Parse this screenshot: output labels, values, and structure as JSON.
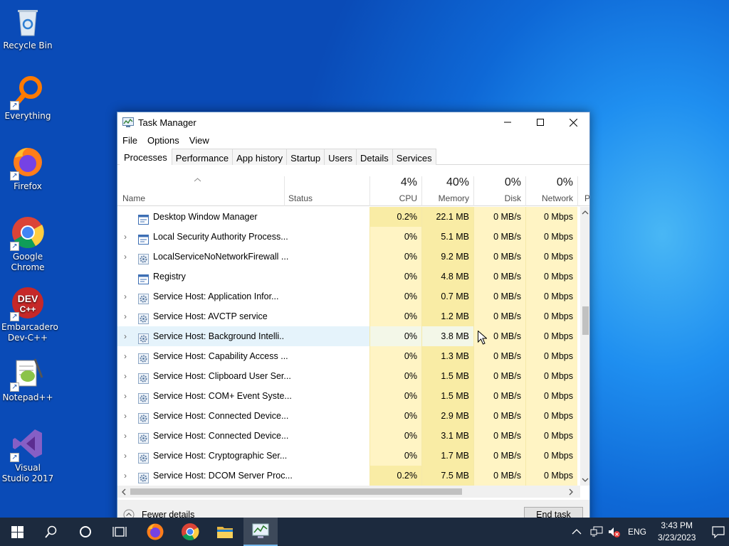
{
  "desktop": {
    "icons": [
      {
        "label": "Recycle Bin",
        "icon": "recycle-bin-icon"
      },
      {
        "label": "Everything",
        "icon": "everything-search-icon"
      },
      {
        "label": "Firefox",
        "icon": "firefox-icon"
      },
      {
        "label": "Google Chrome",
        "icon": "chrome-icon"
      },
      {
        "label": "Embarcadero Dev-C++",
        "icon": "devcpp-icon",
        "badge": "DEV C++"
      },
      {
        "label": "Notepad++",
        "icon": "notepadpp-icon"
      },
      {
        "label": "Visual Studio 2017",
        "icon": "visual-studio-icon"
      }
    ]
  },
  "window": {
    "title": "Task Manager",
    "menu": [
      "File",
      "Options",
      "View"
    ],
    "tabs": [
      "Processes",
      "Performance",
      "App history",
      "Startup",
      "Users",
      "Details",
      "Services"
    ],
    "active_tab": "Processes",
    "columns": {
      "name": "Name",
      "status": "Status",
      "cpu": {
        "label": "CPU",
        "pct": "4%"
      },
      "memory": {
        "label": "Memory",
        "pct": "40%"
      },
      "disk": {
        "label": "Disk",
        "pct": "0%"
      },
      "network": {
        "label": "Network",
        "pct": "0%"
      },
      "power": "P"
    },
    "processes": [
      {
        "name": "Desktop Window Manager",
        "cpu": "0.2%",
        "memory": "22.1 MB",
        "disk": "0 MB/s",
        "network": "0 Mbps",
        "expandable": false,
        "icon": "window-process-icon"
      },
      {
        "name": "Local Security Authority Process...",
        "cpu": "0%",
        "memory": "5.1 MB",
        "disk": "0 MB/s",
        "network": "0 Mbps",
        "expandable": true,
        "icon": "window-process-icon"
      },
      {
        "name": "LocalServiceNoNetworkFirewall ...",
        "cpu": "0%",
        "memory": "9.2 MB",
        "disk": "0 MB/s",
        "network": "0 Mbps",
        "expandable": true,
        "icon": "service-gear-icon"
      },
      {
        "name": "Registry",
        "cpu": "0%",
        "memory": "4.8 MB",
        "disk": "0 MB/s",
        "network": "0 Mbps",
        "expandable": false,
        "icon": "window-process-icon"
      },
      {
        "name": "Service Host: Application Infor...",
        "cpu": "0%",
        "memory": "0.7 MB",
        "disk": "0 MB/s",
        "network": "0 Mbps",
        "expandable": true,
        "icon": "service-gear-icon"
      },
      {
        "name": "Service Host: AVCTP service",
        "cpu": "0%",
        "memory": "1.2 MB",
        "disk": "0 MB/s",
        "network": "0 Mbps",
        "expandable": true,
        "icon": "service-gear-icon"
      },
      {
        "name": "Service Host: Background Intelli...",
        "cpu": "0%",
        "memory": "3.8 MB",
        "disk": "0 MB/s",
        "network": "0 Mbps",
        "expandable": true,
        "icon": "service-gear-icon",
        "highlighted": true
      },
      {
        "name": "Service Host: Capability Access ...",
        "cpu": "0%",
        "memory": "1.3 MB",
        "disk": "0 MB/s",
        "network": "0 Mbps",
        "expandable": true,
        "icon": "service-gear-icon"
      },
      {
        "name": "Service Host: Clipboard User Ser...",
        "cpu": "0%",
        "memory": "1.5 MB",
        "disk": "0 MB/s",
        "network": "0 Mbps",
        "expandable": true,
        "icon": "service-gear-icon"
      },
      {
        "name": "Service Host: COM+ Event Syste...",
        "cpu": "0%",
        "memory": "1.5 MB",
        "disk": "0 MB/s",
        "network": "0 Mbps",
        "expandable": true,
        "icon": "service-gear-icon"
      },
      {
        "name": "Service Host: Connected Device...",
        "cpu": "0%",
        "memory": "2.9 MB",
        "disk": "0 MB/s",
        "network": "0 Mbps",
        "expandable": true,
        "icon": "service-gear-icon"
      },
      {
        "name": "Service Host: Connected Device...",
        "cpu": "0%",
        "memory": "3.1 MB",
        "disk": "0 MB/s",
        "network": "0 Mbps",
        "expandable": true,
        "icon": "service-gear-icon"
      },
      {
        "name": "Service Host: Cryptographic Ser...",
        "cpu": "0%",
        "memory": "1.7 MB",
        "disk": "0 MB/s",
        "network": "0 Mbps",
        "expandable": true,
        "icon": "service-gear-icon"
      },
      {
        "name": "Service Host: DCOM Server Proc...",
        "cpu": "0.2%",
        "memory": "7.5 MB",
        "disk": "0 MB/s",
        "network": "0 Mbps",
        "expandable": true,
        "icon": "service-gear-icon"
      }
    ],
    "footer": {
      "fewer_details": "Fewer details",
      "end_task": "End task"
    }
  },
  "taskbar": {
    "buttons": [
      "start-icon",
      "search-icon",
      "cortana-icon",
      "task-view-icon",
      "firefox-icon",
      "chrome-icon",
      "file-explorer-icon",
      "task-manager-icon"
    ],
    "language": "ENG",
    "time": "3:43 PM",
    "date": "3/23/2023"
  },
  "colors": {
    "desktop_blue": "#0e68d6",
    "taskbar": "#1c2a3e",
    "heat_light": "#fff4c4",
    "heat_medium": "#f9eca5",
    "row_highlight": "#e5f3fb"
  }
}
